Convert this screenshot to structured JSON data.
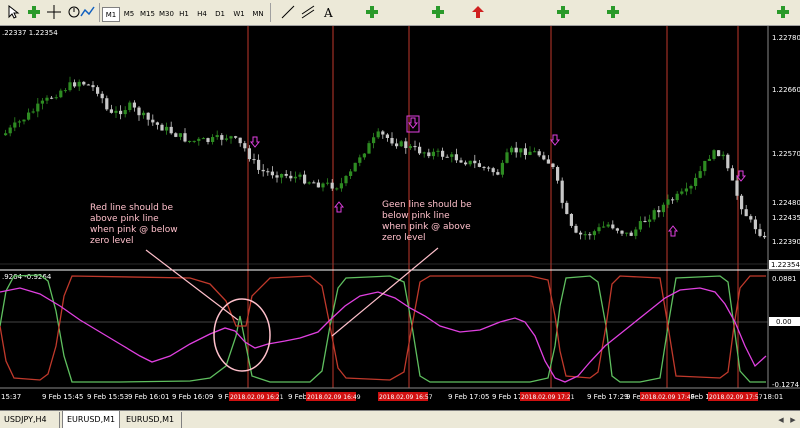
{
  "toolbar": {
    "timeframes": [
      "M1",
      "M5",
      "M15",
      "M30",
      "H1",
      "H4",
      "D1",
      "W1",
      "MN"
    ],
    "selected": "M1",
    "icons": [
      "new-order-icon",
      "crosshair-icon",
      "period-icon",
      "indicator-icon",
      "line-icon",
      "channel-icon",
      "text-icon",
      "arrow-icon"
    ]
  },
  "price_panel": {
    "info": ".22337 1.22354",
    "axis_labels": [
      "1.22780",
      "1.22660",
      "1.22570",
      "1.22480",
      "1.22435",
      "1.22390",
      "1.22354"
    ],
    "current_price": "1.22354"
  },
  "indicator_panel": {
    "info": ".9264 -0.9264",
    "axis_labels": [
      "0.0881",
      "0.00",
      "-0.1274"
    ]
  },
  "time_axis": {
    "labels": [
      "15:37",
      "9 Feb 15:45",
      "9 Feb 15:53",
      "9 Feb 16:01",
      "9 Feb 16:09",
      "9 Feb 16:",
      "9 Feb 16:",
      "9 Feb 16:57",
      "9 Feb 17:05",
      "9 Feb 17:13",
      "9 Feb 17:29",
      "9 Feb 1",
      "9 Feb 17:",
      "18:01"
    ],
    "highlighted": [
      "2018.02.09 16:21",
      "2018.02.09 16:49",
      "2018.02.09 16:57",
      "2018.02.09 17:21",
      "2018.02.09 17:49",
      "2018.02.09 17:57"
    ]
  },
  "annotations": {
    "red_note": [
      "Red line should be",
      "above pink line",
      "when pink @ below",
      "zero level"
    ],
    "green_note": [
      "Geen line should be",
      "below pink line",
      "when pink @ above",
      "zero level"
    ]
  },
  "tabs": {
    "items": [
      "USDJPY,H4",
      "EURUSD,M1",
      "EURUSD,M1"
    ],
    "active_index": 1
  },
  "colors": {
    "bull_candle": "#2e8b22",
    "bear_candle": "#c8c8c8",
    "vline": "#c0392b",
    "pink": "#e040e0",
    "green_line": "#5fbf5f",
    "red_line": "#c0392b",
    "annotation_text": "#ffc0cb"
  }
}
